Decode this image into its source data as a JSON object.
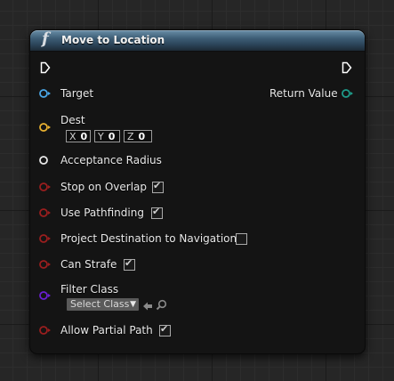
{
  "node": {
    "title": "Move to Location",
    "icon": "function-icon",
    "pins": {
      "target": {
        "label": "Target",
        "color": "#4aa7e8"
      },
      "return_value": {
        "label": "Return Value",
        "color": "#1e9c8a"
      },
      "dest": {
        "label": "Dest",
        "color": "#e8b030",
        "x": {
          "axis": "X",
          "value": "0"
        },
        "y": {
          "axis": "Y",
          "value": "0"
        },
        "z": {
          "axis": "Z",
          "value": "0"
        }
      },
      "acceptance_radius": {
        "label": "Acceptance Radius",
        "color": "#e8e8e8"
      },
      "stop_on_overlap": {
        "label": "Stop on Overlap",
        "checked": true,
        "color": "#9a1e1e"
      },
      "use_pathfinding": {
        "label": "Use Pathfinding",
        "checked": true,
        "color": "#9a1e1e"
      },
      "project_destination": {
        "label": "Project Destination to Navigation",
        "checked": false,
        "color": "#9a1e1e"
      },
      "can_strafe": {
        "label": "Can Strafe",
        "checked": true,
        "color": "#9a1e1e"
      },
      "filter_class": {
        "label": "Filter Class",
        "select_value": "Select Class",
        "color": "#6a1fd1"
      },
      "allow_partial_path": {
        "label": "Allow Partial Path",
        "checked": true,
        "color": "#9a1e1e"
      }
    }
  }
}
